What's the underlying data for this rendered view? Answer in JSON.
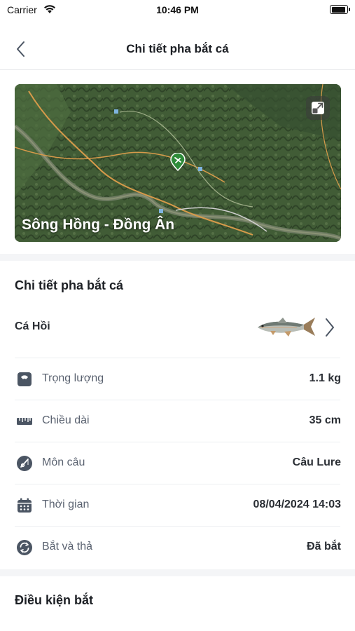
{
  "status_bar": {
    "carrier": "Carrier",
    "time": "10:46 PM"
  },
  "nav": {
    "title": "Chi tiết pha bắt cá",
    "back_icon": "chevron-left-icon"
  },
  "map": {
    "location_name": "Sông Hồng - Đồng Ân",
    "expand_icon": "expand-icon",
    "pin_icon": "fishing-pin-icon"
  },
  "catch_details": {
    "section_title": "Chi tiết pha bắt cá",
    "species": {
      "name": "Cá Hồi",
      "image": "fish-image",
      "chevron_icon": "chevron-right-icon"
    },
    "rows": [
      {
        "icon": "scale-icon",
        "label": "Trọng lượng",
        "value": "1.1 kg"
      },
      {
        "icon": "ruler-icon",
        "label": "Chiều dài",
        "value": "35 cm"
      },
      {
        "icon": "fishing-rod-icon",
        "label": "Môn câu",
        "value": "Câu Lure"
      },
      {
        "icon": "calendar-icon",
        "label": "Thời gian",
        "value": "08/04/2024 14:03"
      },
      {
        "icon": "catch-release-icon",
        "label": "Bắt và thả",
        "value": "Đã bắt"
      }
    ]
  },
  "conditions": {
    "section_title": "Điều kiện bắt"
  },
  "colors": {
    "accent_green": "#2e8b3a",
    "icon_gray": "#4b5563",
    "text_primary": "#1c1f24",
    "text_secondary": "#5a6270"
  }
}
